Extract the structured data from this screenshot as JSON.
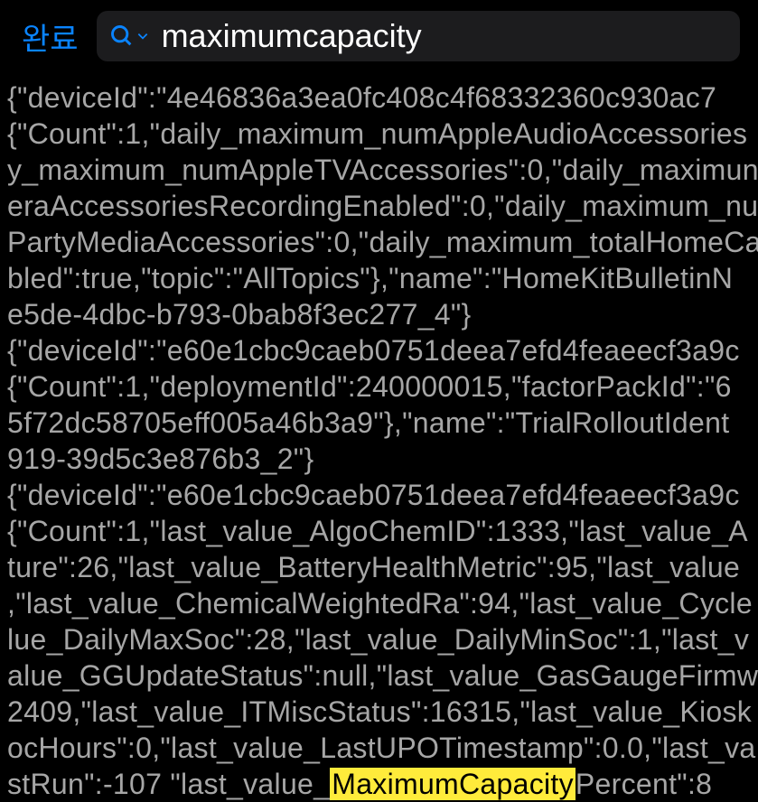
{
  "topbar": {
    "done_label": "완료",
    "search_value": "maximumcapacity"
  },
  "content": {
    "lines": [
      "{\"deviceId\":\"4e46836a3ea0fc408c4f68332360c930ac7",
      "{\"Count\":1,\"daily_maximum_numAppleAudioAccessories",
      "y_maximum_numAppleTVAccessories\":0,\"daily_maximun",
      "eraAccessoriesRecordingEnabled\":0,\"daily_maximum_nu",
      "PartyMediaAccessories\":0,\"daily_maximum_totalHomeCa",
      "bled\":true,\"topic\":\"AllTopics\"},\"name\":\"HomeKitBulletinN",
      "e5de-4dbc-b793-0bab8f3ec277_4\"}",
      "{\"deviceId\":\"e60e1cbc9caeb0751deea7efd4feaeecf3a9c",
      "{\"Count\":1,\"deploymentId\":240000015,\"factorPackId\":\"6",
      "5f72dc58705eff005a46b3a9\"},\"name\":\"TrialRolloutIdent",
      "919-39d5c3e876b3_2\"}",
      "{\"deviceId\":\"e60e1cbc9caeb0751deea7efd4feaeecf3a9c",
      "{\"Count\":1,\"last_value_AlgoChemID\":1333,\"last_value_A",
      "ture\":26,\"last_value_BatteryHealthMetric\":95,\"last_value",
      ",\"last_value_ChemicalWeightedRa\":94,\"last_value_Cycle",
      "lue_DailyMaxSoc\":28,\"last_value_DailyMinSoc\":1,\"last_v",
      "alue_GGUpdateStatus\":null,\"last_value_GasGaugeFirmw",
      "2409,\"last_value_ITMiscStatus\":16315,\"last_value_Kiosk",
      "ocHours\":0,\"last_value_LastUPOTimestamp\":0.0,\"last_va"
    ],
    "highlighted_line_prefix": "stRun\":-107 \"last_value_",
    "highlighted_text": "MaximumCapacity",
    "highlighted_line_suffix": "Percent\":8"
  }
}
